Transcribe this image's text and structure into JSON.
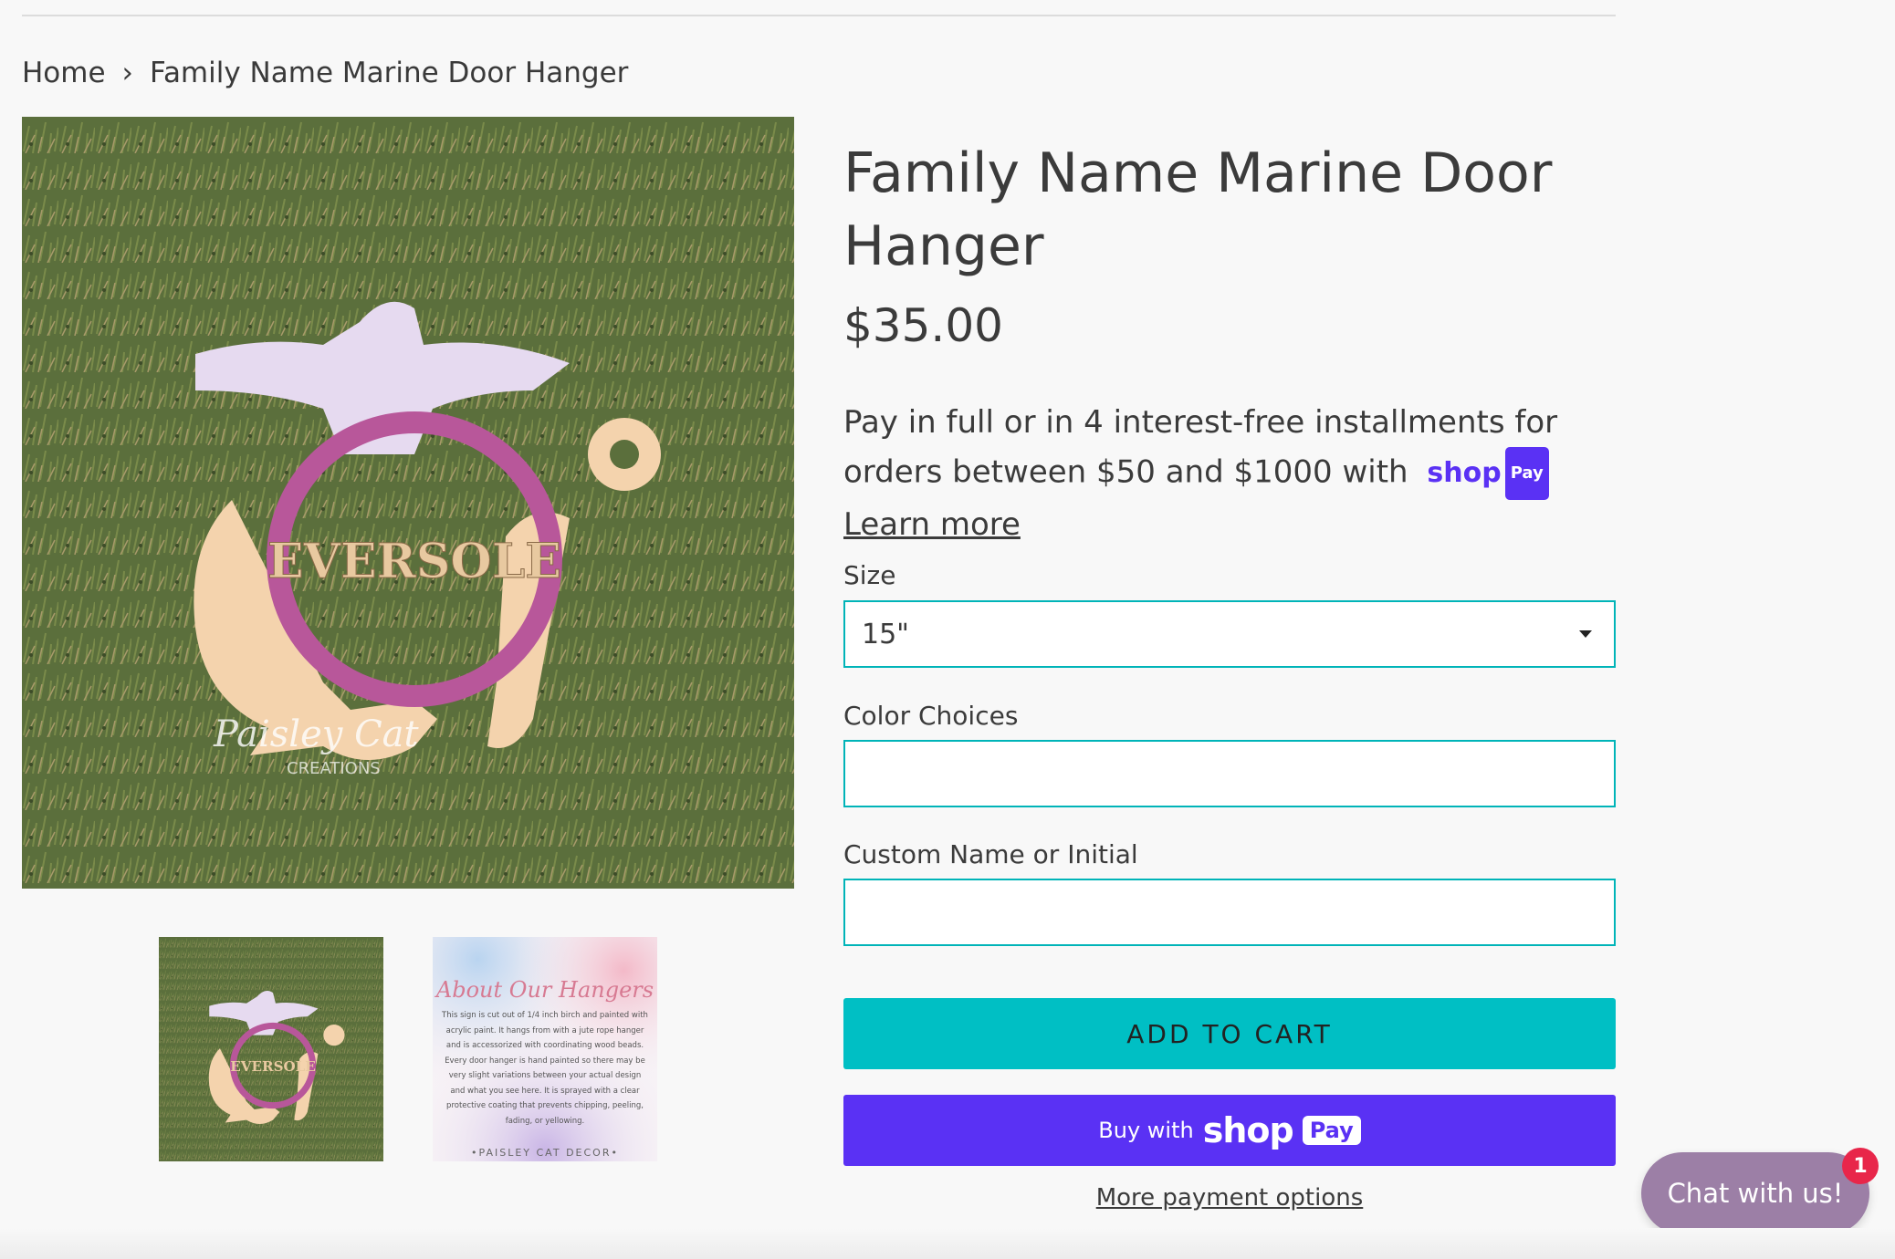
{
  "breadcrumb": {
    "home": "Home",
    "separator": "›",
    "current": "Family Name Marine Door Hanger"
  },
  "product": {
    "title": "Family Name Marine Door Hanger",
    "price": "$35.00",
    "installments_text": "Pay in full or in 4 interest-free installments for orders between $50 and $1000 with",
    "shoppay_shop": "shop",
    "shoppay_pay": "Pay",
    "learn_more": "Learn more"
  },
  "image_text": {
    "monogram_name": "EVERSOLE",
    "watermark_top": "Paisley Cat",
    "watermark_bottom": "CREATIONS",
    "about_heading": "About Our Hangers",
    "about_body": "This sign is cut out of 1/4 inch birch and painted with acrylic paint. It hangs from with a jute rope hanger and is accessorized with coordinating wood beads. Every door hanger is hand painted so there may be very slight variations between your actual design and what you see here. It is sprayed with a clear protective coating that prevents chipping, peeling, fading, or yellowing.",
    "about_footer": "•PAISLEY CAT DECOR•"
  },
  "form": {
    "size_label": "Size",
    "size_value": "15\"",
    "color_label": "Color Choices",
    "color_value": "",
    "custom_label": "Custom Name or Initial",
    "custom_value": ""
  },
  "buttons": {
    "add_to_cart": "ADD TO CART",
    "buy_with": "Buy with",
    "buy_shop": "shop",
    "buy_pay": "Pay",
    "more_payment": "More payment options"
  },
  "chat": {
    "label": "Chat with us!",
    "badge": "1"
  },
  "colors": {
    "accent": "#00bfc4",
    "shoppay": "#5a31f4",
    "chat": "#9c7fa6",
    "badge": "#e8264a"
  }
}
